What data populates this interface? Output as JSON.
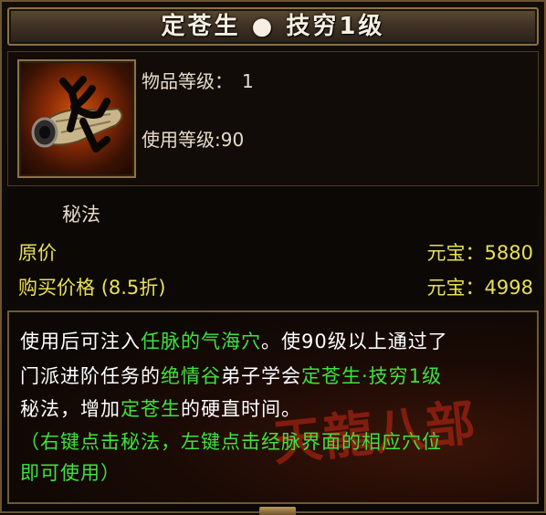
{
  "title": "定苍生 ● 技穷1级",
  "item_info": {
    "item_level_label": "物品等级：",
    "item_level_value": "1",
    "use_level_label": "使用等级",
    "use_level_value": ":90"
  },
  "category": "秘法",
  "price": {
    "original_label": "原价",
    "original_value": "元宝：5880",
    "purchase_label": "购买价格",
    "discount": "(8.5折)",
    "purchase_value": "元宝：4998"
  },
  "description": {
    "line1": [
      {
        "t": "使用后可注入",
        "c": "w"
      },
      {
        "t": "任脉的气海穴",
        "c": "g"
      },
      {
        "t": "。使90级以上通过了",
        "c": "w"
      }
    ],
    "line2": [
      {
        "t": "门派进阶任务的",
        "c": "w"
      },
      {
        "t": "绝情谷",
        "c": "g"
      },
      {
        "t": "弟子学会",
        "c": "w"
      },
      {
        "t": "定苍生·技穷1级",
        "c": "g"
      }
    ],
    "line3": [
      {
        "t": "秘法，增加",
        "c": "w"
      },
      {
        "t": "定苍生",
        "c": "g"
      },
      {
        "t": "的硬直时间。",
        "c": "w"
      }
    ],
    "hint_line1": "（右键点击秘法，左键点击经脉界面的相应穴位",
    "hint_line2": "即可使用）"
  },
  "colors": {
    "title_text": "#f6efe2",
    "label_yellow": "#e8e058",
    "desc_white": "#ffffff",
    "desc_green": "#3ee23e",
    "border_gold": "#8a7043"
  },
  "icons": {
    "item_icon": "scroll-with-rune-icon"
  }
}
